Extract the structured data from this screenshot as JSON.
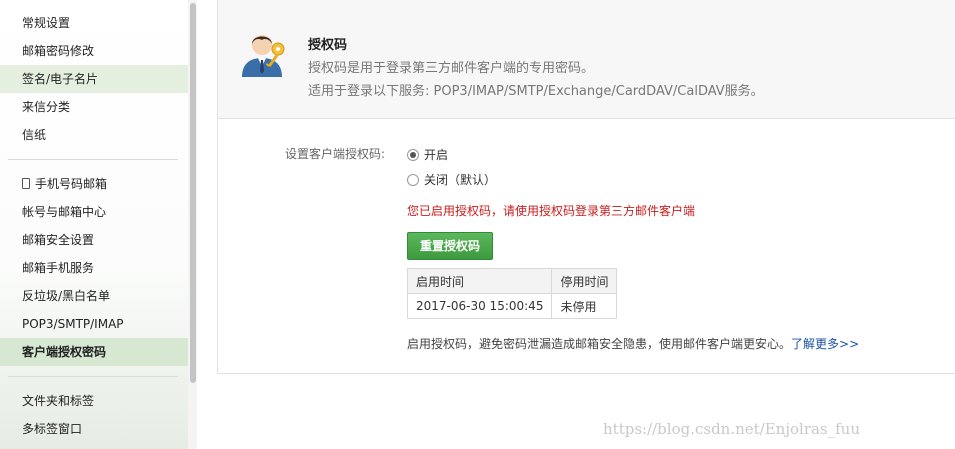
{
  "sidebar": {
    "group1": [
      {
        "label": "常规设置"
      },
      {
        "label": "邮箱密码修改"
      },
      {
        "label": "签名/电子名片"
      },
      {
        "label": "来信分类"
      },
      {
        "label": "信纸"
      }
    ],
    "group2": [
      {
        "label": "手机号码邮箱"
      },
      {
        "label": "帐号与邮箱中心"
      },
      {
        "label": "邮箱安全设置"
      },
      {
        "label": "邮箱手机服务"
      },
      {
        "label": "反垃圾/黑白名单"
      },
      {
        "label": "POP3/SMTP/IMAP"
      },
      {
        "label": "客户端授权密码"
      }
    ],
    "group3": [
      {
        "label": "文件夹和标签"
      },
      {
        "label": "多标签窗口"
      }
    ]
  },
  "header": {
    "title": "授权码",
    "desc1": "授权码是用于登录第三方邮件客户端的专用密码。",
    "desc2": "适用于登录以下服务: POP3/IMAP/SMTP/Exchange/CardDAV/CalDAV服务。"
  },
  "form": {
    "label": "设置客户端授权码:",
    "option_on": "开启",
    "option_off": "关闭（默认）",
    "selected": "on",
    "warning": "您已启用授权码，请使用授权码登录第三方邮件客户端",
    "reset_button": "重置授权码"
  },
  "table": {
    "headers": [
      "启用时间",
      "停用时间"
    ],
    "rows": [
      [
        "2017-06-30 15:00:45",
        "未停用"
      ]
    ]
  },
  "footer": {
    "note": "启用授权码，避免密码泄漏造成邮箱安全隐患，使用邮件客户端更安心。",
    "link": "了解更多>>"
  },
  "watermark": "https://blog.csdn.net/Enjolras_fuu",
  "colors": {
    "accent_green": "#4cae4c",
    "warning_red": "#c81c1c",
    "link_blue": "#1a52a3"
  }
}
